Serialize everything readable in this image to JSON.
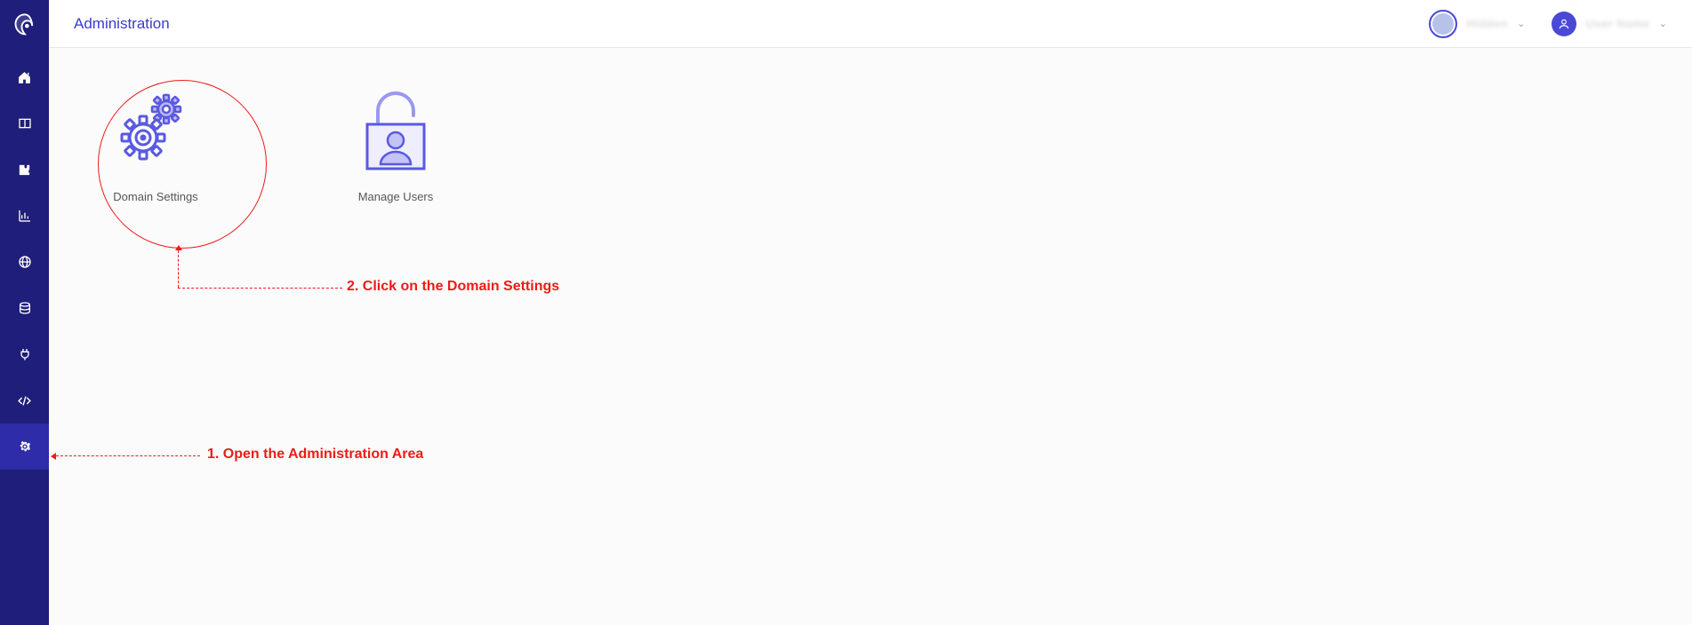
{
  "header": {
    "title": "Administration",
    "tenant_label": "Hidden",
    "user_label": "User Name"
  },
  "cards": {
    "domain_settings": "Domain Settings",
    "manage_users": "Manage Users"
  },
  "annotations": {
    "step1": "1. Open the Administration Area",
    "step2": "2. Click on the Domain Settings"
  }
}
